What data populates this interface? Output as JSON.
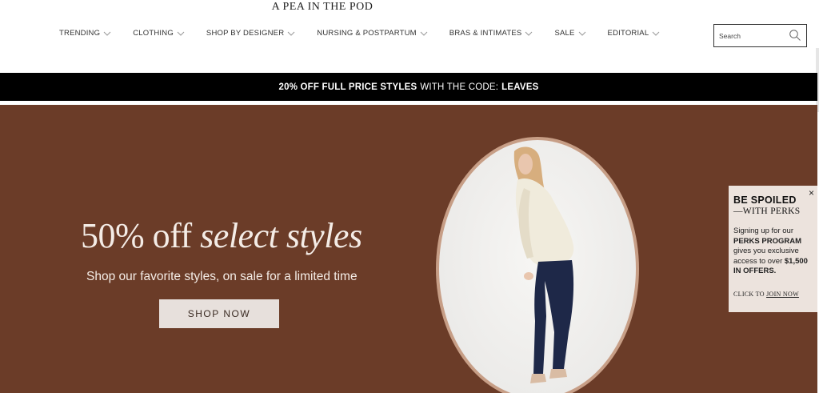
{
  "logo": "A PEA IN THE POD",
  "nav": {
    "items": [
      {
        "label": "TRENDING"
      },
      {
        "label": "CLOTHING"
      },
      {
        "label": "SHOP BY DESIGNER"
      },
      {
        "label": "NURSING & POSTPARTUM"
      },
      {
        "label": "BRAS & INTIMATES"
      },
      {
        "label": "SALE"
      },
      {
        "label": "EDITORIAL"
      }
    ]
  },
  "search": {
    "placeholder": "Search",
    "icon": "magnifier-icon"
  },
  "promo": {
    "bold1": "20% OFF FULL PRICE STYLES",
    "regular": "WITH THE CODE:",
    "bold2": "LEAVES"
  },
  "hero": {
    "headline_regular": "50% off ",
    "headline_italic": "select styles",
    "subline": "Shop our favorite styles, on sale for a limited time",
    "button": "SHOP NOW",
    "colors": {
      "background": "#6b3c28",
      "frame": "#c79e86"
    }
  },
  "perks": {
    "title1": "BE SPOILED",
    "title2": "—WITH PERKS",
    "body_a": "Signing up for our ",
    "body_b": "PERKS PROGRAM",
    "body_c": " gives you exclusive access to over ",
    "body_d": "$1,500 IN OFFERS.",
    "cta_prefix": "CLICK TO ",
    "cta_link": "JOIN NOW",
    "close": "×"
  }
}
